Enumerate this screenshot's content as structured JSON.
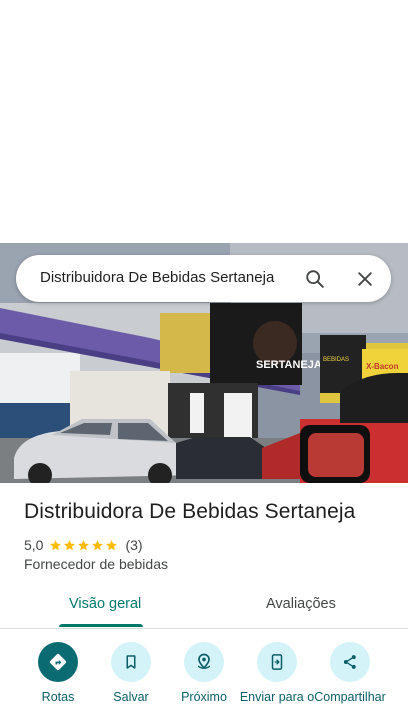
{
  "search": {
    "query": "Distribuidora De Bebidas Sertaneja",
    "search_icon": "search-icon",
    "close_icon": "close-icon"
  },
  "photo": {
    "storefront_sign": "SERTANEJA",
    "side_sign": "X-Bacon",
    "side_sign_small": "BEBIDAS"
  },
  "place": {
    "name": "Distribuidora De Bebidas Sertaneja",
    "rating": "5,0",
    "stars": 5,
    "review_count": "(3)",
    "category": "Fornecedor de bebidas"
  },
  "tabs": [
    {
      "label": "Visão geral",
      "active": true
    },
    {
      "label": "Avaliações",
      "active": false
    }
  ],
  "actions": [
    {
      "label": "Rotas",
      "icon": "directions-icon"
    },
    {
      "label": "Salvar",
      "icon": "bookmark-icon"
    },
    {
      "label": "Próximo",
      "icon": "nearby-icon"
    },
    {
      "label": "Enviar para o",
      "icon": "send-to-phone-icon"
    },
    {
      "label": "Compartilhar",
      "icon": "share-icon"
    }
  ],
  "colors": {
    "accent": "#00796b",
    "primary_action": "#0b6b73",
    "action_bg": "#d3f3f9",
    "star": "#fbbc04"
  }
}
